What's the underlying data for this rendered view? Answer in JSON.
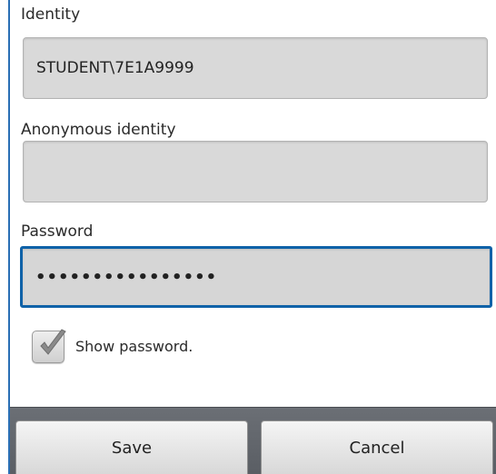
{
  "form": {
    "identity_label": "Identity",
    "identity_value": "STUDENT\\7E1A9999",
    "anonymous_label": "Anonymous identity",
    "anonymous_value": "",
    "password_label": "Password",
    "password_value": "••••••••••••••••",
    "show_password_label": "Show password.",
    "show_password_checked": true
  },
  "buttons": {
    "save_label": "Save",
    "cancel_label": "Cancel"
  },
  "icons": {
    "checkmark": "checkmark-icon"
  },
  "colors": {
    "focus_border": "#0f62a8",
    "field_bg": "#d9d9d9",
    "button_bar": "#5f6369"
  }
}
